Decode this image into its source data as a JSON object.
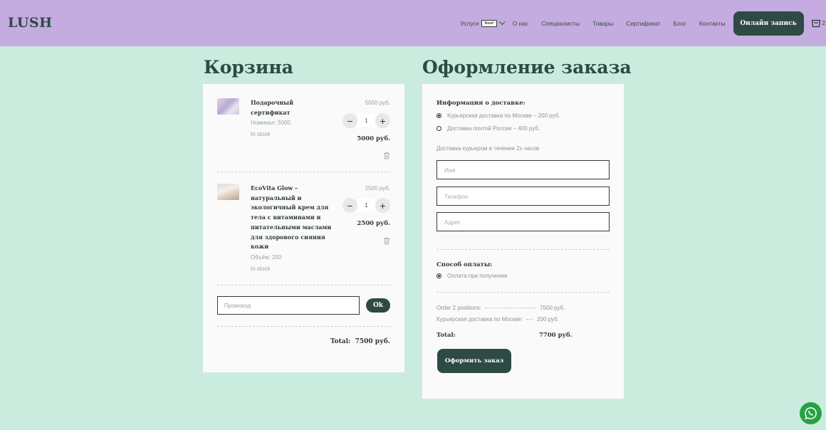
{
  "header": {
    "logo": "LUSH",
    "nav": {
      "services": "Услуги",
      "services_badge": "New!",
      "about": "О нас",
      "specialists": "Специалисты",
      "products": "Товары",
      "certificate": "Сертификат",
      "blog": "Блог",
      "contacts": "Контакты"
    },
    "cta_label": "Онлайн запись",
    "cart_count": "2"
  },
  "cart": {
    "title": "Корзина",
    "items": [
      {
        "name": "Подарочный сертификат",
        "detail": "Номинал: 5000",
        "stock": "In stock",
        "price": "5000 руб.",
        "qty": "1",
        "subtotal": "5000 руб."
      },
      {
        "name": "EcoVita Glow – натуральный и экологичный крем для тела с витаминами и питательными маслами для здорового сияния кожи",
        "detail": "Объём: 250",
        "stock": "In stock",
        "price": "2500 руб.",
        "qty": "1",
        "subtotal": "2500 руб."
      }
    ],
    "promo_placeholder": "Промокод",
    "promo_button": "Ok",
    "total_label": "Total:",
    "total_value": "7500 руб."
  },
  "order": {
    "title": "Оформление заказа",
    "delivery_title": "Информация о доставке:",
    "delivery_options": [
      {
        "label": "Курьерская доставка по Москве – 200 руб.",
        "selected": true
      },
      {
        "label": "Доставка почтой России – 400 руб.",
        "selected": false
      }
    ],
    "delivery_note": "Доставка курьером в течении 2х часов",
    "fields": {
      "name_placeholder": "Имя",
      "phone_placeholder": "Телефон",
      "address_placeholder": "Адрес"
    },
    "payment_title": "Способ оплаты:",
    "payment_option": "Оплата при получении",
    "summary": {
      "positions_label": "Order 2 positions:",
      "positions_value": "7500 руб.",
      "delivery_label": "Курьерская доставка по Москве:",
      "delivery_value": "200 руб.",
      "total_label": "Total:",
      "total_value": "7700 руб."
    },
    "submit_label": "Оформить заказ"
  },
  "colors": {
    "page_bg": "#c9ecde",
    "header_bg": "#c4abe0",
    "accent": "#2e4a44",
    "whatsapp": "#25a244"
  }
}
